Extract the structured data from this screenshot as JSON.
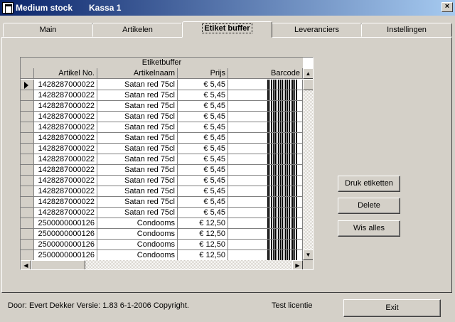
{
  "window": {
    "app_title": "Medium stock",
    "subtitle": "Kassa 1",
    "close_glyph": "×"
  },
  "tabs": [
    {
      "label": "Main",
      "active": false
    },
    {
      "label": "Artikelen",
      "active": false
    },
    {
      "label": "Etiket buffer",
      "active": true
    },
    {
      "label": "Leveranciers",
      "active": false
    },
    {
      "label": "Instellingen",
      "active": false
    }
  ],
  "grid": {
    "caption": "Etiketbuffer",
    "columns": [
      "Artikel No.",
      "Artikelnaam",
      "Prijs",
      "Barcode"
    ],
    "rows": [
      {
        "artikel_no": "1428287000022",
        "naam": "Satan red 75cl",
        "prijs": "€ 5,45",
        "current": true
      },
      {
        "artikel_no": "1428287000022",
        "naam": "Satan red 75cl",
        "prijs": "€ 5,45"
      },
      {
        "artikel_no": "1428287000022",
        "naam": "Satan red 75cl",
        "prijs": "€ 5,45"
      },
      {
        "artikel_no": "1428287000022",
        "naam": "Satan red 75cl",
        "prijs": "€ 5,45"
      },
      {
        "artikel_no": "1428287000022",
        "naam": "Satan red 75cl",
        "prijs": "€ 5,45"
      },
      {
        "artikel_no": "1428287000022",
        "naam": "Satan red 75cl",
        "prijs": "€ 5,45"
      },
      {
        "artikel_no": "1428287000022",
        "naam": "Satan red 75cl",
        "prijs": "€ 5,45"
      },
      {
        "artikel_no": "1428287000022",
        "naam": "Satan red 75cl",
        "prijs": "€ 5,45"
      },
      {
        "artikel_no": "1428287000022",
        "naam": "Satan red 75cl",
        "prijs": "€ 5,45"
      },
      {
        "artikel_no": "1428287000022",
        "naam": "Satan red 75cl",
        "prijs": "€ 5,45"
      },
      {
        "artikel_no": "1428287000022",
        "naam": "Satan red 75cl",
        "prijs": "€ 5,45"
      },
      {
        "artikel_no": "1428287000022",
        "naam": "Satan red 75cl",
        "prijs": "€ 5,45"
      },
      {
        "artikel_no": "1428287000022",
        "naam": "Satan red 75cl",
        "prijs": "€ 5,45"
      },
      {
        "artikel_no": "2500000000126",
        "naam": "Condooms",
        "prijs": "€ 12,50"
      },
      {
        "artikel_no": "2500000000126",
        "naam": "Condooms",
        "prijs": "€ 12,50"
      },
      {
        "artikel_no": "2500000000126",
        "naam": "Condooms",
        "prijs": "€ 12,50"
      },
      {
        "artikel_no": "2500000000126",
        "naam": "Condooms",
        "prijs": "€ 12,50"
      }
    ]
  },
  "buttons": {
    "druk": "Druk etiketten",
    "delete": "Delete",
    "wis": "Wis alles",
    "exit": "Exit"
  },
  "footer": {
    "copyright": "Door: Evert Dekker Versie: 1.83  6-1-2006 Copyright.",
    "license": "Test licentie"
  },
  "colors": {
    "titlebar_start": "#0a246a",
    "titlebar_end": "#a6caf0",
    "face": "#d4d0c8"
  }
}
